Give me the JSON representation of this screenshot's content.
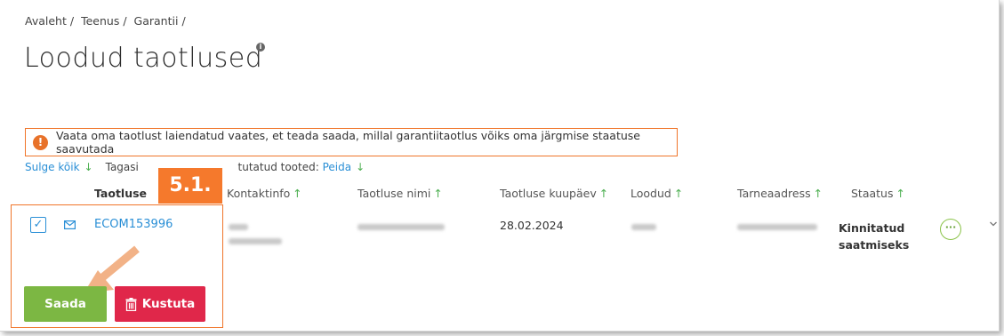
{
  "breadcrumb": [
    "Avaleht",
    "Teenus",
    "Garantii"
  ],
  "page": {
    "title": "Loodud taotlused",
    "info_symbol": "i"
  },
  "notice": {
    "icon": "info-icon",
    "text": "Vaata oma taotlust laiendatud vaates, et teada saada, millal garantiitaotlus võiks oma järgmise staatuse saavutada"
  },
  "toolbar": {
    "collapse_all": "Sulge kõik",
    "returned_prefix": "Tagasi",
    "returned_suffix": "tutatud tooted:",
    "hide_link": "Peida",
    "arrow": "↓"
  },
  "annotation": {
    "step_label": "5.1."
  },
  "table": {
    "headers": {
      "col1": "Taotluse",
      "contact": "Kontaktinfo",
      "name": "Taotluse nimi",
      "date": "Taotluse kuupäev",
      "created": "Loodud",
      "address": "Tarneaadress",
      "status": "Staatus"
    },
    "sort_arrow": "↑",
    "row": {
      "checked_mark": "✓",
      "order_id": "ECOM153996",
      "date": "28.02.2024",
      "status_line1": "Kinnitatud",
      "status_line2": "saatmiseks",
      "more_label": "···"
    }
  },
  "actions": {
    "send_label": "Saada",
    "delete_label": "Kustuta"
  },
  "colors": {
    "accent_orange": "#f5792c",
    "link_blue": "#2a8fd6",
    "send_green": "#7cb743",
    "delete_red": "#e0274a"
  }
}
